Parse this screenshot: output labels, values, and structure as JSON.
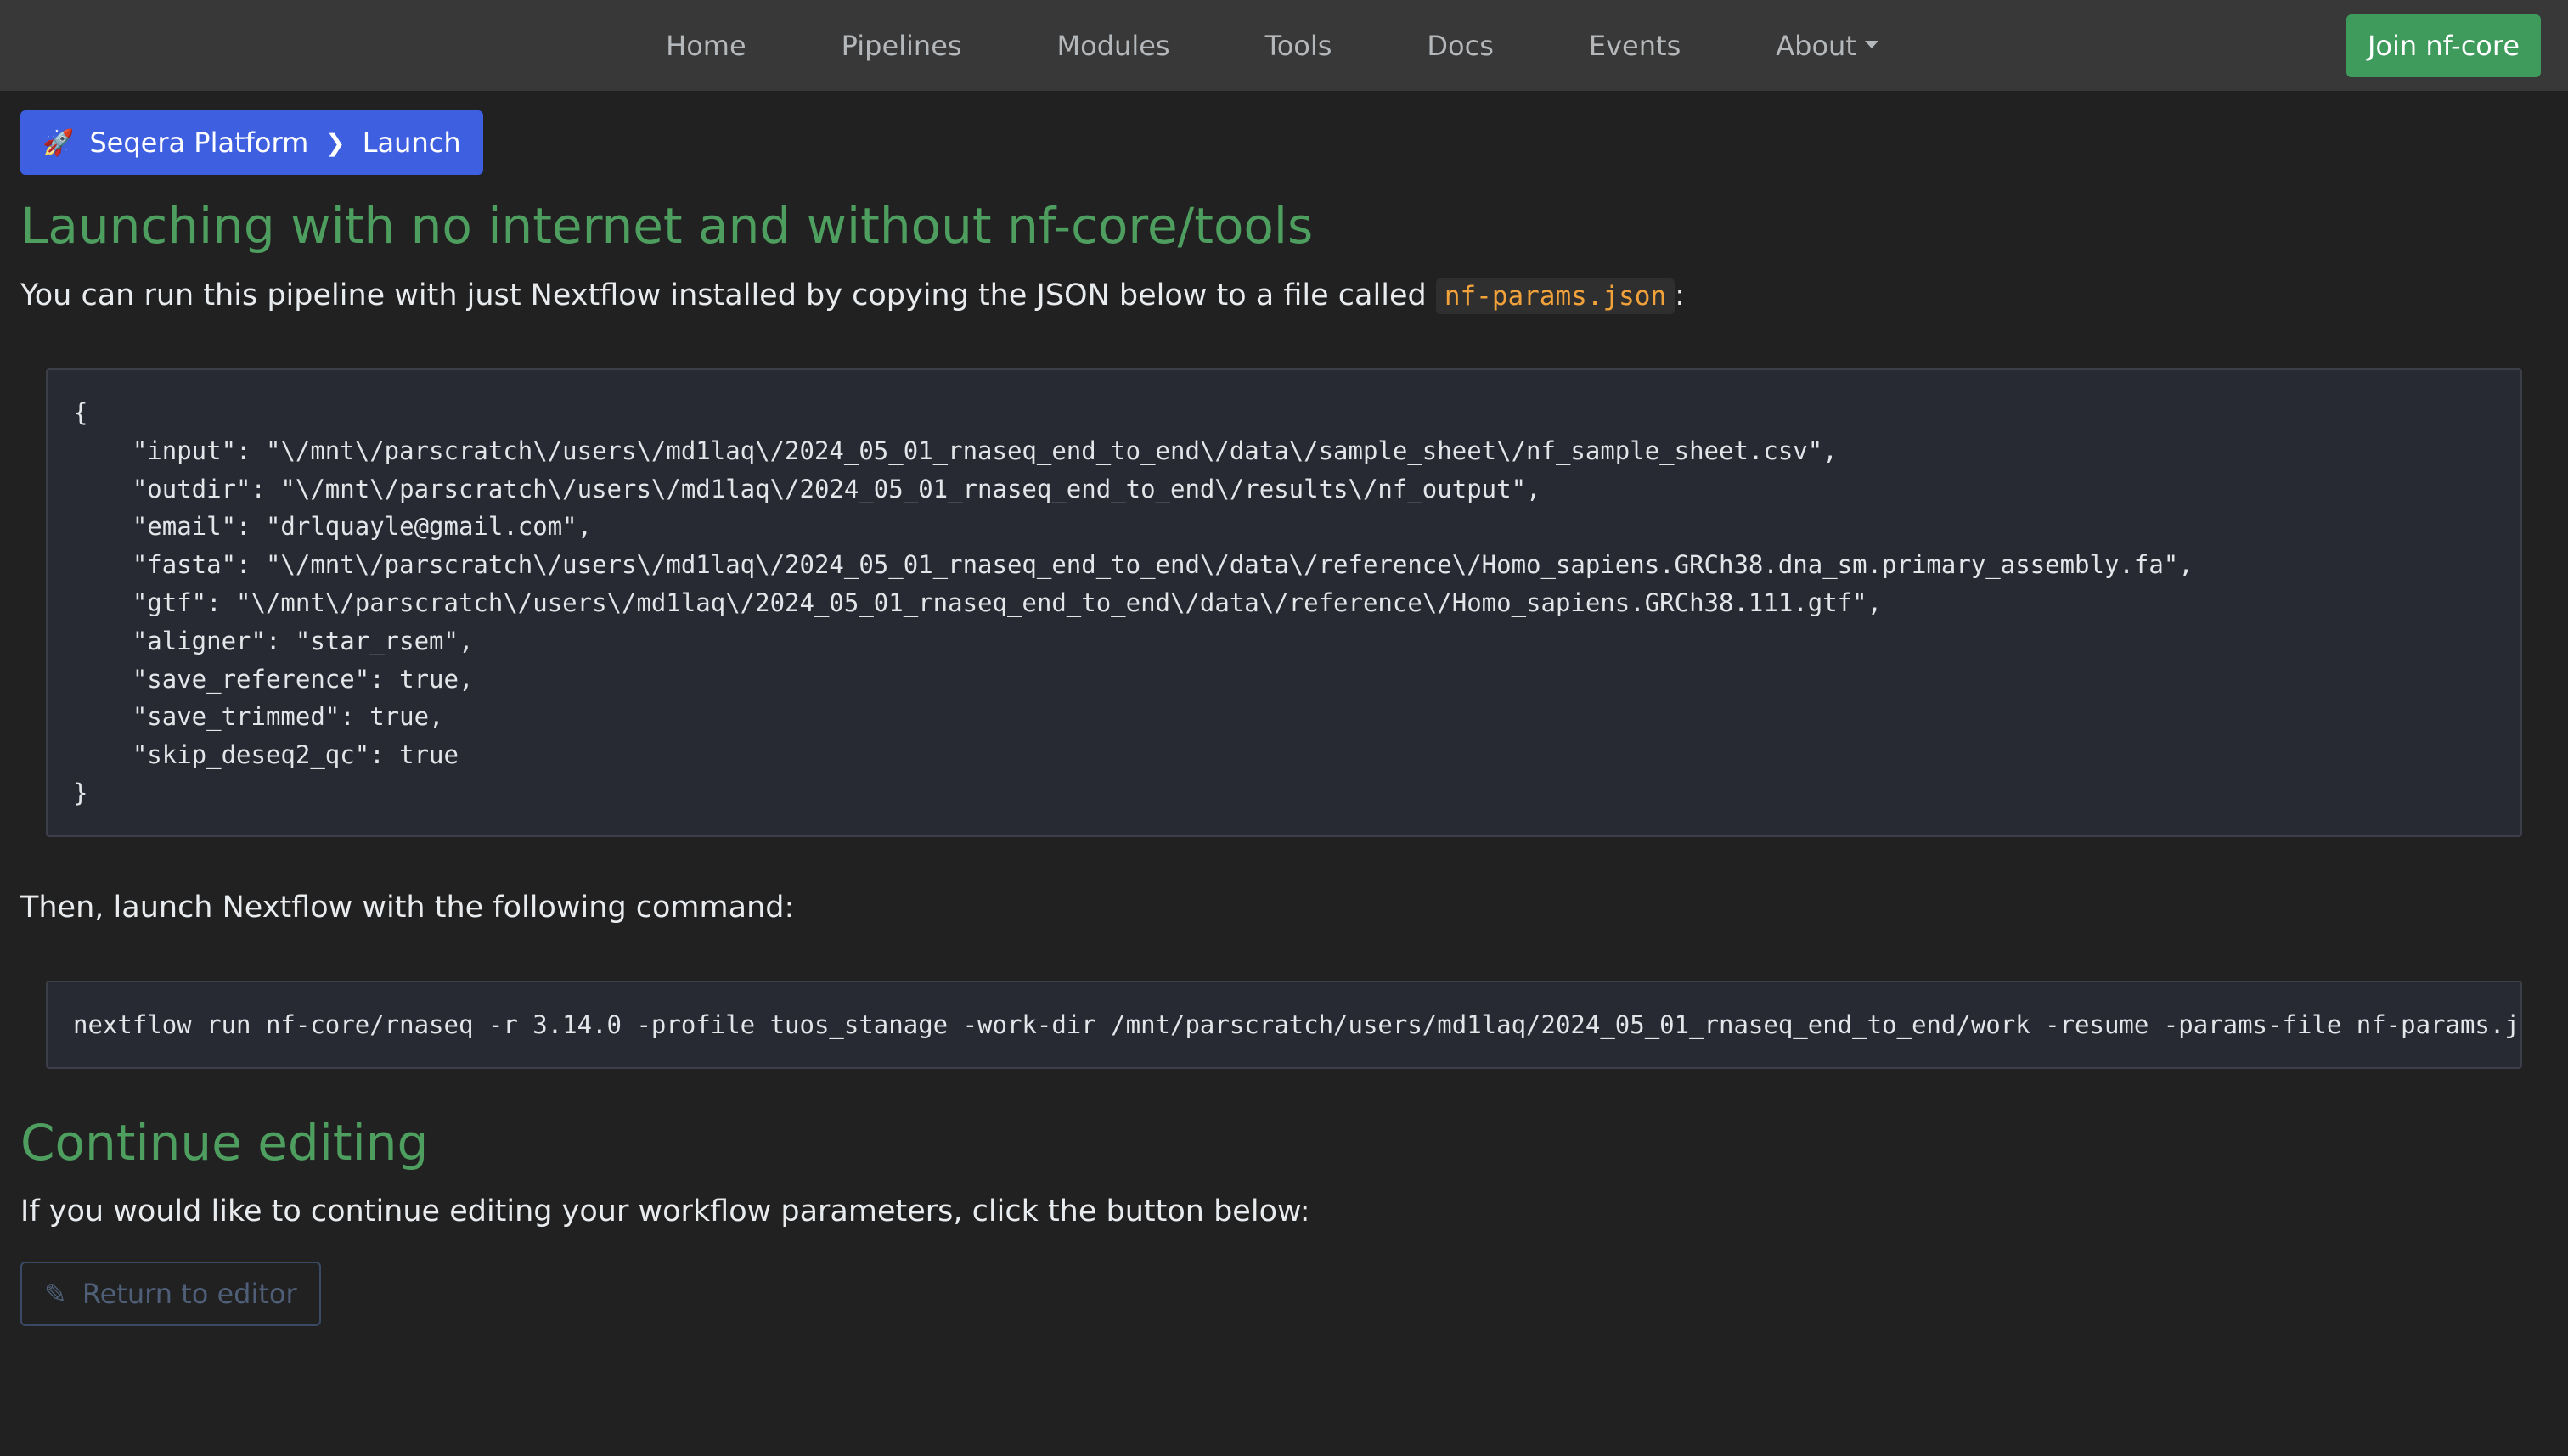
{
  "nav": {
    "items": [
      {
        "label": "Home"
      },
      {
        "label": "Pipelines"
      },
      {
        "label": "Modules"
      },
      {
        "label": "Tools"
      },
      {
        "label": "Docs"
      },
      {
        "label": "Events"
      },
      {
        "label": "About"
      }
    ],
    "join_label": "Join nf-core"
  },
  "breadcrumb": {
    "icon": "rocket-icon",
    "items": [
      "Seqera Platform",
      "Launch"
    ],
    "separator": "❯",
    "color": "#3d5fe0"
  },
  "offline": {
    "title": "Launching with no internet and without nf-core/tools",
    "intro_before": "You can run this pipeline with just Nextflow installed by copying the JSON below to a file called ",
    "filename": "nf-params.json",
    "intro_after": ":",
    "json_lines": [
      "{",
      "    \"input\": \"\\/mnt\\/parscratch\\/users\\/md1laq\\/2024_05_01_rnaseq_end_to_end\\/data\\/sample_sheet\\/nf_sample_sheet.csv\",",
      "    \"outdir\": \"\\/mnt\\/parscratch\\/users\\/md1laq\\/2024_05_01_rnaseq_end_to_end\\/results\\/nf_output\",",
      "    \"email\": \"drlquayle@gmail.com\",",
      "    \"fasta\": \"\\/mnt\\/parscratch\\/users\\/md1laq\\/2024_05_01_rnaseq_end_to_end\\/data\\/reference\\/Homo_sapiens.GRCh38.dna_sm.primary_assembly.fa\",",
      "    \"gtf\": \"\\/mnt\\/parscratch\\/users\\/md1laq\\/2024_05_01_rnaseq_end_to_end\\/data\\/reference\\/Homo_sapiens.GRCh38.111.gtf\",",
      "    \"aligner\": \"star_rsem\",",
      "    \"save_reference\": true,",
      "    \"save_trimmed\": true,",
      "    \"skip_deseq2_qc\": true",
      "}"
    ],
    "then_text": "Then, launch Nextflow with the following command:",
    "command": "nextflow run nf-core/rnaseq -r 3.14.0 -profile tuos_stanage -work-dir /mnt/parscratch/users/md1laq/2024_05_01_rnaseq_end_to_end/work -resume -params-file nf-params.json"
  },
  "continue": {
    "title": "Continue editing",
    "text": "If you would like to continue editing your workflow parameters, click the button below:",
    "button_label": "Return to editor",
    "button_icon": "pencil-icon"
  },
  "colors": {
    "background": "#212121",
    "navbar": "#383838",
    "accent_green": "#4e9e5f",
    "button_green": "#3e9b5c",
    "code_orange": "#f2a23a"
  }
}
